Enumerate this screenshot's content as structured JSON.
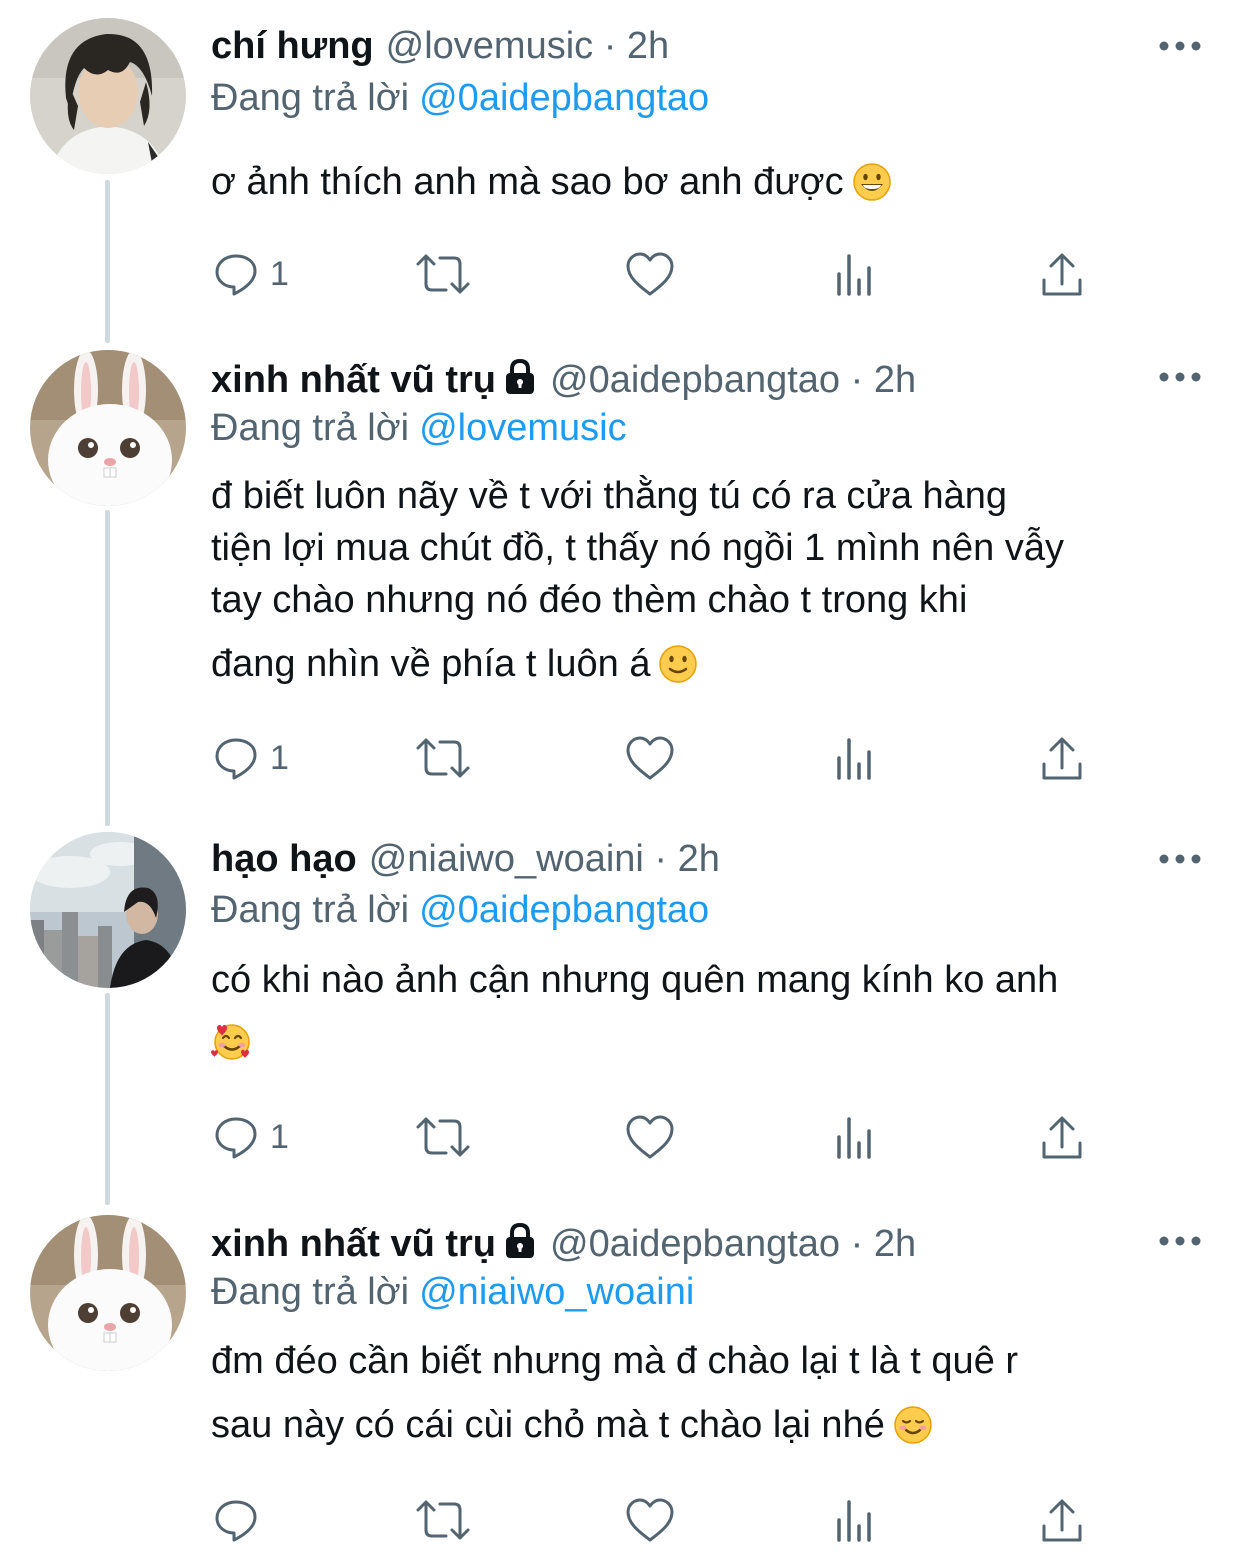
{
  "labels": {
    "replying_to": "Đang trả lời",
    "time_separator": "·"
  },
  "colors": {
    "link": "#1d9bf0",
    "muted": "#536471",
    "text": "#0f1419",
    "thread_line": "#cfd9de"
  },
  "tweets": [
    {
      "name": "chí hưng",
      "protected": false,
      "handle": "@lovemusic",
      "time": "2h",
      "replying_to": "@0aidepbangtao",
      "lines": [
        "ơ ảnh thích anh mà sao bơ anh được"
      ],
      "emoji": "grinning-face",
      "reply_count": "1",
      "avatar": "person-photo"
    },
    {
      "name": "xinh nhất vũ trụ",
      "protected": true,
      "handle": "@0aidepbangtao",
      "time": "2h",
      "replying_to": "@lovemusic",
      "lines": [
        "đ biết luôn nãy về t với thằng tú có ra cửa hàng",
        "tiện lợi mua chút đồ, t thấy nó ngồi 1 mình nên vẫy",
        "tay chào nhưng nó đéo thèm chào t trong khi",
        "đang nhìn về phía t luôn á"
      ],
      "emoji": "slightly-smiling-face",
      "reply_count": "1",
      "avatar": "white-bunny"
    },
    {
      "name": "hạo hạo",
      "protected": false,
      "handle": "@niaiwo_woaini",
      "time": "2h",
      "replying_to": "@0aidepbangtao",
      "lines": [
        "có khi nào ảnh cận nhưng quên mang kính ko anh",
        ""
      ],
      "emoji": "smiling-face-with-hearts",
      "reply_count": "1",
      "avatar": "city-skyline-photo"
    },
    {
      "name": "xinh nhất vũ trụ",
      "protected": true,
      "handle": "@0aidepbangtao",
      "time": "2h",
      "replying_to": "@niaiwo_woaini",
      "lines": [
        "đm đéo cần biết nhưng mà đ chào lại t là t quê r",
        "sau này có cái cùi chỏ mà t chào lại nhé"
      ],
      "emoji": "smiling-face",
      "reply_count": "",
      "avatar": "white-bunny"
    }
  ]
}
